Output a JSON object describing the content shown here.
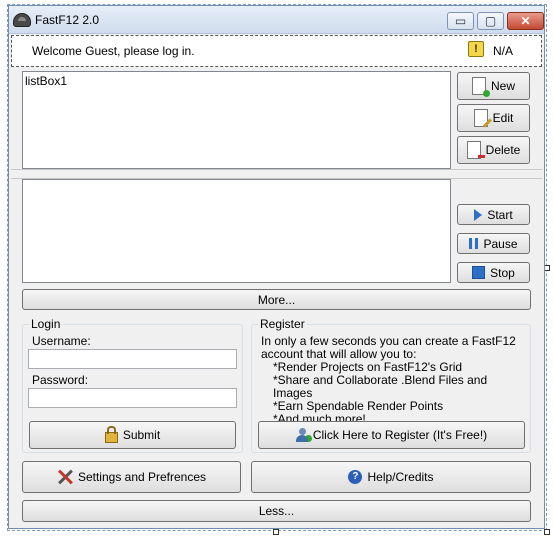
{
  "window": {
    "title": "FastF12 2.0",
    "minimize_glyph": "▭",
    "maximize_glyph": "▢",
    "close_glyph": "✕"
  },
  "status": {
    "welcome_text": "Welcome Guest, please log in.",
    "warning_glyph": "!",
    "value": "N/A"
  },
  "projects": {
    "listbox_label": "listBox1",
    "new_label": "New",
    "edit_label": "Edit",
    "delete_label": "Delete"
  },
  "render": {
    "start_label": "Start",
    "pause_label": "Pause",
    "stop_label": "Stop"
  },
  "more_label": "More...",
  "login": {
    "legend": "Login",
    "username_label": "Username:",
    "username_value": "",
    "password_label": "Password:",
    "password_value": "",
    "submit_label": "Submit"
  },
  "register": {
    "legend": "Register",
    "intro": "In only a few seconds you can create a FastF12 account that will allow you to:",
    "bullets": [
      "*Render Projects on FastF12's Grid",
      "*Share and Collaborate .Blend Files and Images",
      "*Earn Spendable Render Points",
      "*And much more!"
    ],
    "button_label": "Click Here to Register (It's Free!)"
  },
  "settings_label": "Settings and Prefrences",
  "help_label": "Help/Credits",
  "help_glyph": "?",
  "less_label": "Less...",
  "icons": {
    "app": "helmet-icon",
    "warning": "warning-icon",
    "new": "new-document-icon",
    "edit": "edit-document-icon",
    "delete": "delete-document-icon",
    "start": "play-icon",
    "pause": "pause-icon",
    "stop": "stop-icon",
    "submit": "lock-icon",
    "register": "add-user-icon",
    "settings": "tools-icon",
    "help": "help-icon"
  },
  "colors": {
    "accent_blue": "#2d6fc7",
    "warning_yellow": "#f5d64a",
    "close_red": "#c24a33"
  }
}
